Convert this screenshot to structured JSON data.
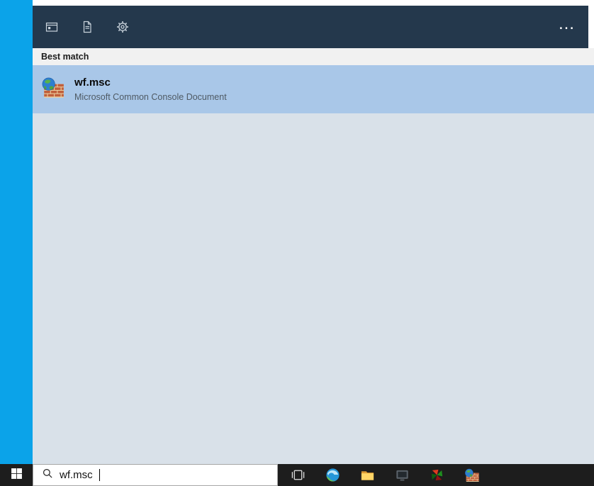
{
  "colors": {
    "desktop_blue": "#0ba3e9",
    "header_bg": "#24384c",
    "selection_blue": "#a9c7e8",
    "panel_body": "#d9e1e9",
    "taskbar_bg": "#1d1d1d"
  },
  "search_panel": {
    "header": {
      "more_label": "…",
      "icons": [
        {
          "name": "apps-filter-icon"
        },
        {
          "name": "documents-filter-icon"
        },
        {
          "name": "settings-gear-icon"
        }
      ]
    },
    "section_label": "Best match",
    "best_match": {
      "icon": "windows-firewall-icon",
      "title": "wf.msc",
      "subtitle": "Microsoft Common Console Document"
    }
  },
  "taskbar": {
    "start": {
      "icon": "windows-start-icon"
    },
    "search": {
      "value": "wf.msc",
      "icon": "search-magnifier-icon"
    },
    "buttons": [
      {
        "name": "task-view-icon"
      },
      {
        "name": "edge-browser-icon"
      },
      {
        "name": "file-explorer-icon"
      },
      {
        "name": "console-window-icon"
      },
      {
        "name": "pinwheel-app-icon"
      },
      {
        "name": "windows-firewall-icon"
      }
    ]
  }
}
